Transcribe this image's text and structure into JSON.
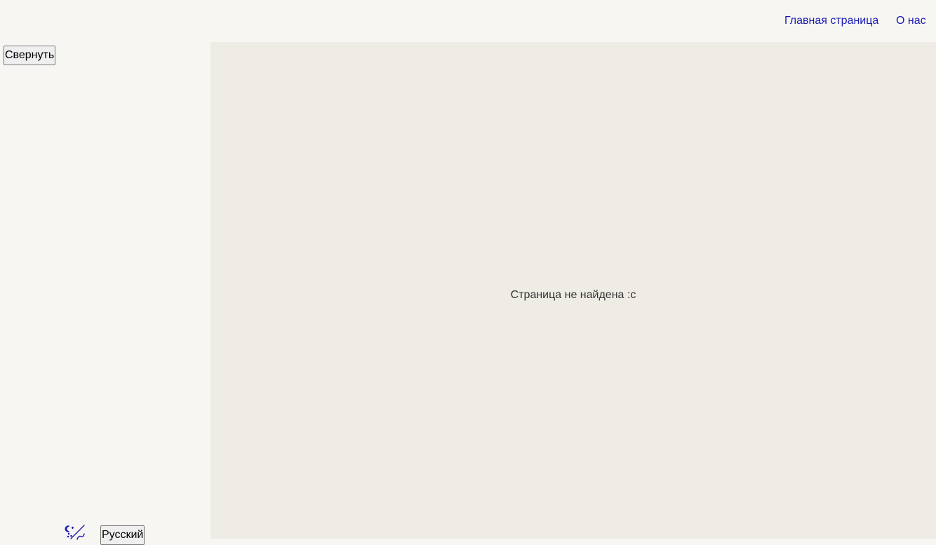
{
  "header": {
    "nav": {
      "home_label": "Главная страница",
      "about_label": "О нас"
    }
  },
  "sidebar": {
    "collapse_label": "Свернуть",
    "theme_toggle_icon": "theme-toggle-icon",
    "language_label": "Русский"
  },
  "main": {
    "message": "Страница не найдена :с"
  },
  "colors": {
    "link": "#1a1ab3",
    "sidebar_bg": "#f7f6f2",
    "main_bg": "#efece6"
  }
}
